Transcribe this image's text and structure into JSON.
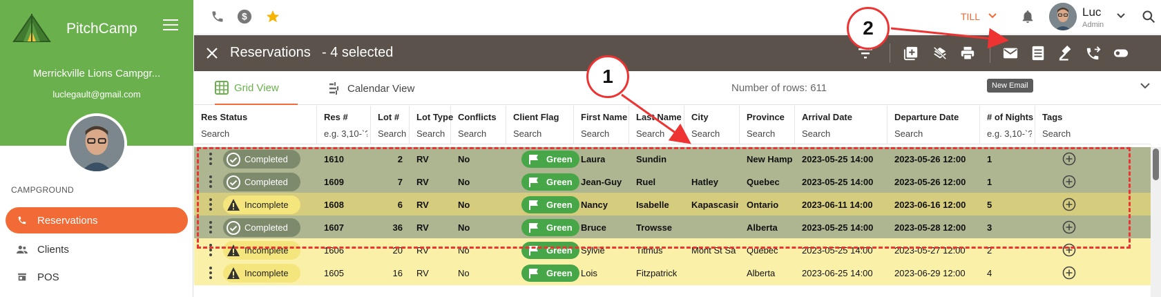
{
  "sidebar": {
    "brand": "PitchCamp",
    "campground_name": "Merrickville Lions Campgr...",
    "email": "luclegault@gmail.com",
    "section_label": "CAMPGROUND",
    "items": [
      {
        "label": "Reservations",
        "icon": "phone-icon",
        "active": true
      },
      {
        "label": "Clients",
        "icon": "people-icon",
        "active": false
      },
      {
        "label": "POS",
        "icon": "store-icon",
        "active": false
      }
    ]
  },
  "topbar": {
    "icons": [
      "phone-icon",
      "dollar-icon",
      "star-icon"
    ],
    "till_label": "TILL",
    "user_name": "Luc",
    "user_role": "Admin"
  },
  "actionbar": {
    "title": "Reservations",
    "selected": "- 4 selected",
    "icons": [
      "filter-icon",
      "add-box-icon",
      "layers-off-icon",
      "print-icon",
      "email-icon",
      "receipt-icon",
      "gavel-icon",
      "phone-forward-icon",
      "toggle-icon"
    ]
  },
  "tabs": {
    "grid_view": "Grid View",
    "calendar_view": "Calendar View",
    "row_count": "Number of rows: 611",
    "tooltip": "New Email"
  },
  "columns": [
    {
      "label": "Res Status",
      "placeholder": "Search"
    },
    {
      "label": "Res #",
      "placeholder": "e.g. 3,10-`?"
    },
    {
      "label": "Lot #",
      "placeholder": "Search"
    },
    {
      "label": "Lot Type",
      "placeholder": "Search"
    },
    {
      "label": "Conflicts",
      "placeholder": "Search"
    },
    {
      "label": "Client Flag",
      "placeholder": "Search"
    },
    {
      "label": "First Name",
      "placeholder": "Search"
    },
    {
      "label": "Last Name",
      "placeholder": "Search"
    },
    {
      "label": "City",
      "placeholder": "Search"
    },
    {
      "label": "Province",
      "placeholder": "Search"
    },
    {
      "label": "Arrival Date",
      "placeholder": "Search"
    },
    {
      "label": "Departure Date",
      "placeholder": "Search"
    },
    {
      "label": "# of Nights",
      "placeholder": "e.g. 3,10-`?"
    },
    {
      "label": "Tags",
      "placeholder": "Search"
    }
  ],
  "rows": [
    {
      "selected": true,
      "status": "Completed",
      "res": "1610",
      "lot": "2",
      "lot_type": "RV",
      "conflicts": "No",
      "flag": "Green",
      "first": "Laura",
      "last": "Sundin",
      "city": "",
      "province": "New Hamp",
      "arrival": "2023-05-25 14:00",
      "departure": "2023-05-26 12:00",
      "nights": "1"
    },
    {
      "selected": true,
      "status": "Completed",
      "res": "1609",
      "lot": "7",
      "lot_type": "RV",
      "conflicts": "No",
      "flag": "Green",
      "first": "Jean-Guy",
      "last": "Ruel",
      "city": "Hatley",
      "province": "Quebec",
      "arrival": "2023-05-25 14:00",
      "departure": "2023-05-26 12:00",
      "nights": "1"
    },
    {
      "selected": true,
      "status": "Incomplete",
      "res": "1608",
      "lot": "6",
      "lot_type": "RV",
      "conflicts": "No",
      "flag": "Green",
      "first": "Nancy",
      "last": "Isabelle",
      "city": "Kapascasir",
      "province": "Ontario",
      "arrival": "2023-06-11 14:00",
      "departure": "2023-06-16 12:00",
      "nights": "5"
    },
    {
      "selected": true,
      "status": "Completed",
      "res": "1607",
      "lot": "36",
      "lot_type": "RV",
      "conflicts": "No",
      "flag": "Green",
      "first": "Bruce",
      "last": "Trowsse",
      "city": "",
      "province": "Alberta",
      "arrival": "2023-05-25 14:00",
      "departure": "2023-05-28 12:00",
      "nights": "3"
    },
    {
      "selected": false,
      "status": "Incomplete",
      "res": "1606",
      "lot": "20",
      "lot_type": "RV",
      "conflicts": "No",
      "flag": "Green",
      "first": "Sylvie",
      "last": "Titmus",
      "city": "Mont St Sa",
      "province": "Quebec",
      "arrival": "2023-05-25 14:00",
      "departure": "2023-05-27 12:00",
      "nights": "2"
    },
    {
      "selected": false,
      "status": "Incomplete",
      "res": "1605",
      "lot": "16",
      "lot_type": "RV",
      "conflicts": "No",
      "flag": "Green",
      "first": "Lois",
      "last": "Fitzpatrick",
      "city": "",
      "province": "Alberta",
      "arrival": "2023-06-25 14:00",
      "departure": "2023-06-29 12:00",
      "nights": "4"
    }
  ],
  "annotations": [
    {
      "label": "1"
    },
    {
      "label": "2"
    }
  ],
  "colors": {
    "brand_green": "#6ab04c",
    "accent_orange": "#f26a35",
    "action_bar": "#5b524b",
    "annotation_red": "#e33333",
    "flag_green": "#47a648"
  }
}
